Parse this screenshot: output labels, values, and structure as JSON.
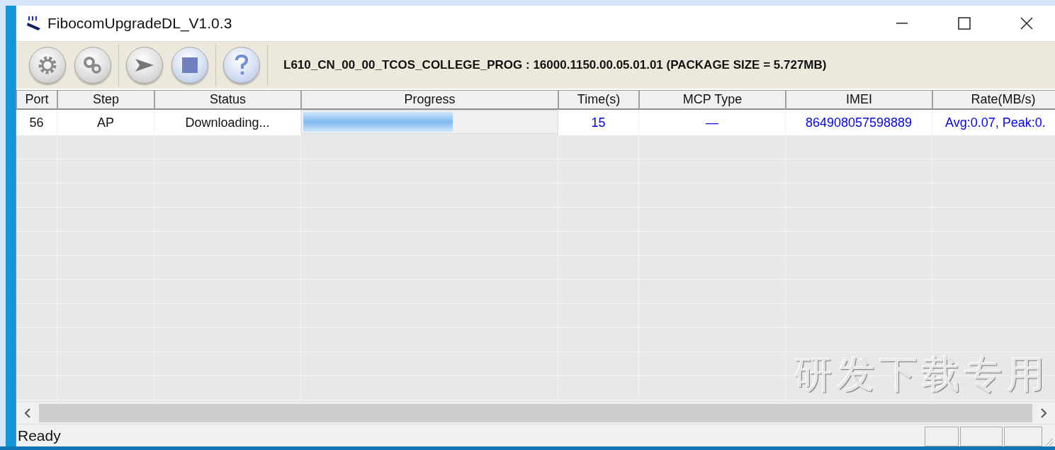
{
  "window": {
    "title": "FibocomUpgradeDL_V1.0.3"
  },
  "toolbar": {
    "buttons": [
      {
        "kind": "gear",
        "disabled": true
      },
      {
        "kind": "gears",
        "disabled": true
      },
      {
        "kind": "play",
        "disabled": true
      },
      {
        "kind": "stop",
        "disabled": false
      },
      {
        "kind": "help",
        "disabled": false
      }
    ],
    "package_info": "L610_CN_00_00_TCOS_COLLEGE_PROG : 16000.1150.00.05.01.01 (PACKAGE SIZE = 5.727MB)"
  },
  "table": {
    "columns": [
      "Port",
      "Step",
      "Status",
      "Progress",
      "Time(s)",
      "MCP Type",
      "IMEI",
      "Rate(MB/s)"
    ],
    "rows": [
      {
        "port": "56",
        "step": "AP",
        "status": "Downloading...",
        "progress": {
          "level": 0.59
        },
        "time": "15",
        "mcp_type": "—",
        "imei": "864908057598889",
        "rate": "Avg:0.07, Peak:0."
      }
    ]
  },
  "overlay_text": "研发下载专用",
  "status_bar": {
    "text": "Ready"
  }
}
